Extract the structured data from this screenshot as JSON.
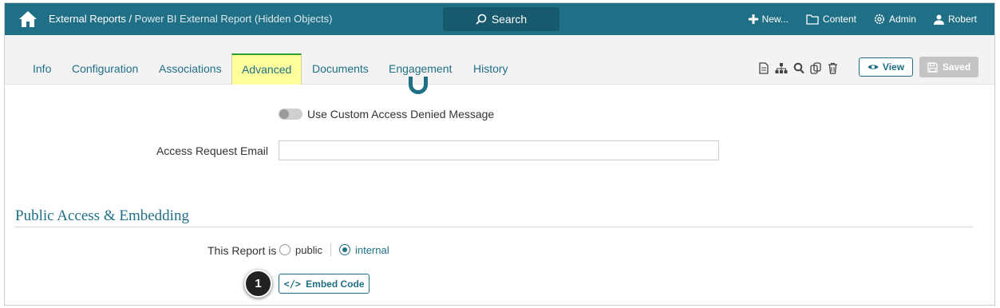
{
  "topbar": {
    "breadcrumb_parent": "External Reports",
    "breadcrumb_separator": " / ",
    "breadcrumb_current": "Power BI External Report (Hidden Objects)",
    "search_label": "Search",
    "new_label": "New...",
    "content_label": "Content",
    "admin_label": "Admin",
    "user_label": "Robert"
  },
  "tabs": [
    {
      "label": "Info"
    },
    {
      "label": "Configuration"
    },
    {
      "label": "Associations"
    },
    {
      "label": "Advanced",
      "active": true
    },
    {
      "label": "Documents"
    },
    {
      "label": "Engagement"
    },
    {
      "label": "History"
    }
  ],
  "toolbar": {
    "icons": [
      "document-icon",
      "hierarchy-icon",
      "search-icon",
      "copy-icon",
      "trash-icon"
    ],
    "view_label": "View",
    "saved_label": "Saved"
  },
  "form": {
    "custom_denied_label": "Use Custom Access Denied Message",
    "access_request_email_label": "Access Request Email",
    "access_request_email_value": ""
  },
  "public_access": {
    "section_title": "Public Access & Embedding",
    "report_is_label": "This Report is",
    "options": [
      {
        "label": "public",
        "selected": false
      },
      {
        "label": "internal",
        "selected": true
      }
    ],
    "embed_code_label": "Embed Code"
  },
  "callout": {
    "number": "1"
  },
  "colors": {
    "brand": "#1f6f86",
    "active_tab": "#ffff9e",
    "active_tab_border": "#2e9e2e",
    "saved_button": "#c4c4c4"
  }
}
